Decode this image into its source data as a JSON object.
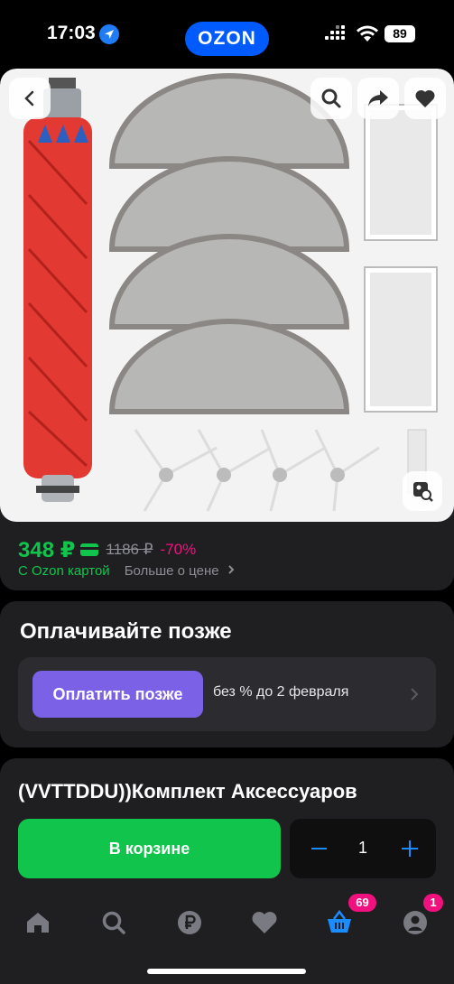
{
  "status": {
    "time": "17:03",
    "battery": "89",
    "brand": "OZON"
  },
  "icons": {
    "back": "chevron-left-icon",
    "search": "search-icon",
    "share": "share-icon",
    "favorite": "heart-icon",
    "visual_search": "image-search-icon"
  },
  "price": {
    "current": "348 ₽",
    "old": "1186 ₽",
    "discount": "-70%",
    "with_card": "С Ozon картой",
    "more": "Больше о цене"
  },
  "pay_later": {
    "title": "Оплачивайте позже",
    "button": "Оплатить позже",
    "note": "без % до 2 февраля"
  },
  "product": {
    "title": "(VVTTDDU))Комплект Аксессуаров",
    "cart_button": "В корзине",
    "quantity": "1"
  },
  "nav": {
    "cart_badge": "69",
    "profile_badge": "1"
  },
  "colors": {
    "brand_blue": "#005bff",
    "green": "#10c44c",
    "pink": "#f1117e",
    "purple": "#7b61e6",
    "accent_blue": "#1a8cff"
  }
}
